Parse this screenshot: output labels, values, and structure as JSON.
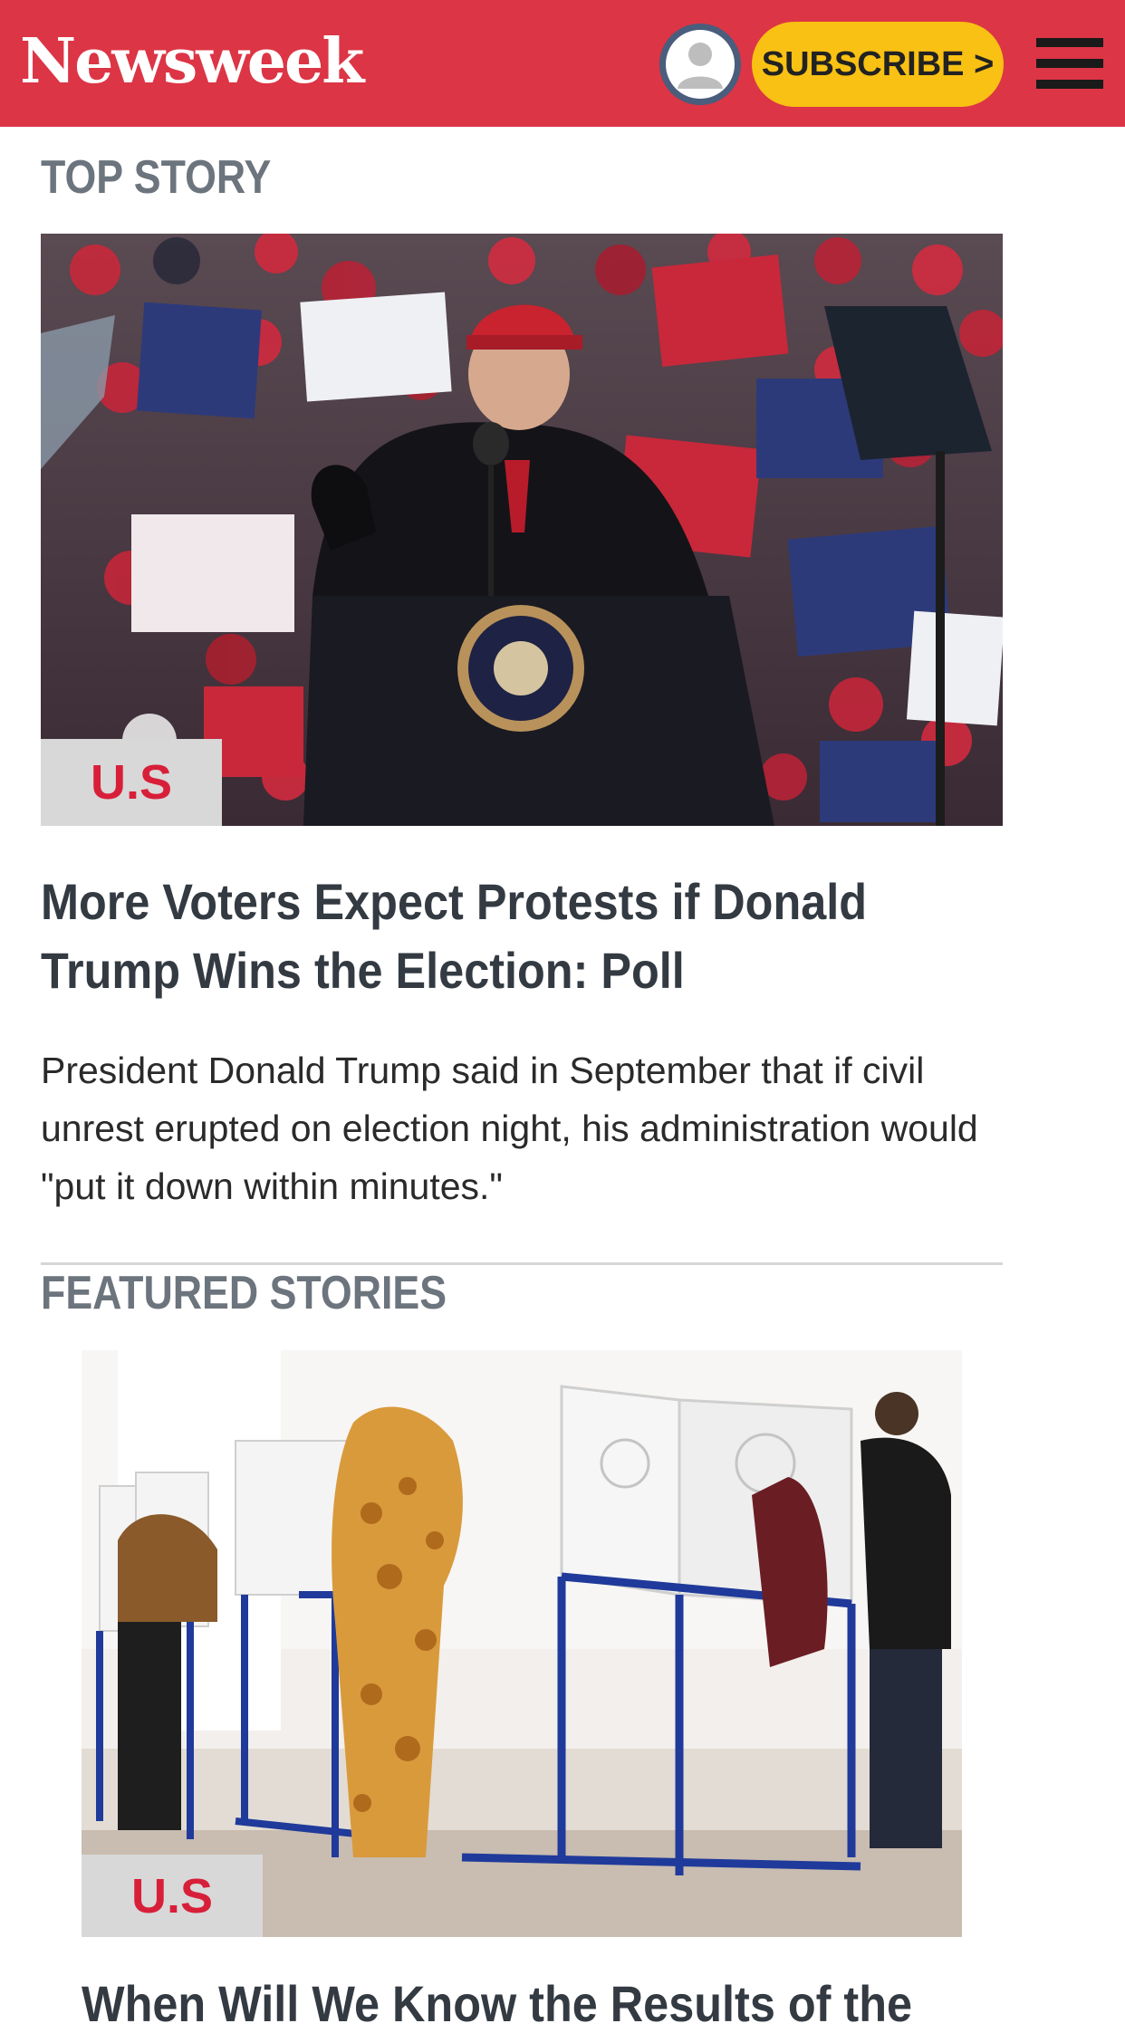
{
  "header": {
    "logo": "Newsweek",
    "subscribe_label": "SUBSCRIBE >",
    "brand_color": "#dc3545",
    "accent_color": "#f9c113",
    "icons": {
      "account": "user-avatar-icon",
      "menu": "hamburger-menu-icon"
    }
  },
  "top_story": {
    "section_label": "TOP STORY",
    "category": "U.S",
    "headline": "More Voters Expect Protests if Donald Trump Wins the Election: Poll",
    "summary": "President Donald Trump said in September that if civil unrest erupted on election night, his administration would \"put it down within minutes.\""
  },
  "featured": {
    "section_label": "FEATURED STORIES",
    "category": "U.S",
    "next_headline_partial": "When Will We Know the Results of the"
  }
}
